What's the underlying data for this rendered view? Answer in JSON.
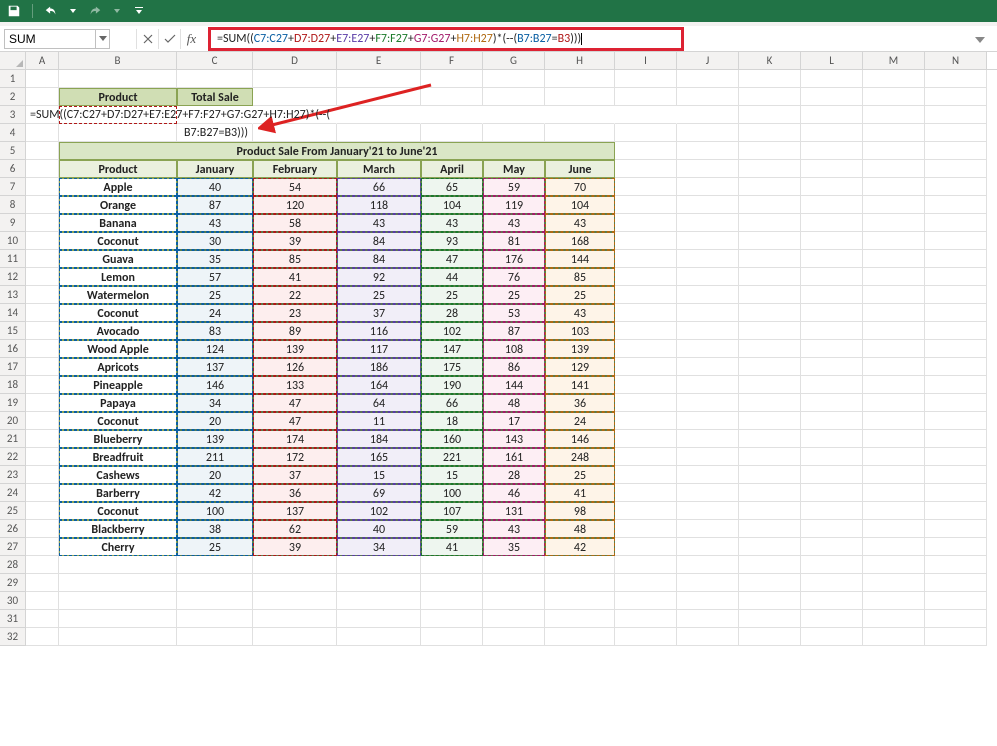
{
  "app": {
    "name_box": "SUM"
  },
  "formula_bar": {
    "prefix": "=SUM((",
    "r1": "C7:C27",
    "plus": "+",
    "r2": "D7:D27",
    "r3": "E7:E27",
    "r4": "F7:F27",
    "r5": "G7:G27",
    "r6": "H7:H27",
    "mid": ")*(--(",
    "r7": "B7:B27",
    "eq": "=",
    "r8": "B3",
    "suffix": ")))"
  },
  "cols": [
    "A",
    "B",
    "C",
    "D",
    "E",
    "F",
    "G",
    "H",
    "I",
    "J",
    "K",
    "L",
    "M",
    "N"
  ],
  "small_table": {
    "h1": "Product",
    "h2": "Total Sale",
    "r3a": "=SUM((C7:C27+D7:D27+E7:E27+F7:F27+G7:G27+H7:H27)*(--(",
    "r4a": "B7:B27=B3)))"
  },
  "main_table": {
    "title": "Product Sale From January'21 to June'21",
    "headers": [
      "Product",
      "January",
      "February",
      "March",
      "April",
      "May",
      "June"
    ],
    "rows": [
      [
        "Apple",
        "40",
        "54",
        "66",
        "65",
        "59",
        "70"
      ],
      [
        "Orange",
        "87",
        "120",
        "118",
        "104",
        "119",
        "104"
      ],
      [
        "Banana",
        "43",
        "58",
        "43",
        "43",
        "43",
        "43"
      ],
      [
        "Coconut",
        "30",
        "39",
        "84",
        "93",
        "81",
        "168"
      ],
      [
        "Guava",
        "35",
        "85",
        "84",
        "47",
        "176",
        "144"
      ],
      [
        "Lemon",
        "57",
        "41",
        "92",
        "44",
        "76",
        "85"
      ],
      [
        "Watermelon",
        "25",
        "22",
        "25",
        "25",
        "25",
        "25"
      ],
      [
        "Coconut",
        "24",
        "23",
        "37",
        "28",
        "53",
        "43"
      ],
      [
        "Avocado",
        "83",
        "89",
        "116",
        "102",
        "87",
        "103"
      ],
      [
        "Wood Apple",
        "124",
        "139",
        "117",
        "147",
        "108",
        "139"
      ],
      [
        "Apricots",
        "137",
        "126",
        "186",
        "175",
        "86",
        "129"
      ],
      [
        "Pineapple",
        "146",
        "133",
        "164",
        "190",
        "144",
        "141"
      ],
      [
        "Papaya",
        "34",
        "47",
        "64",
        "66",
        "48",
        "36"
      ],
      [
        "Coconut",
        "20",
        "47",
        "11",
        "18",
        "17",
        "24"
      ],
      [
        "Blueberry",
        "139",
        "174",
        "184",
        "160",
        "143",
        "146"
      ],
      [
        "Breadfruit",
        "211",
        "172",
        "165",
        "221",
        "161",
        "248"
      ],
      [
        "Cashews",
        "20",
        "37",
        "15",
        "15",
        "28",
        "25"
      ],
      [
        "Barberry",
        "42",
        "36",
        "69",
        "100",
        "46",
        "41"
      ],
      [
        "Coconut",
        "100",
        "137",
        "102",
        "107",
        "131",
        "98"
      ],
      [
        "Blackberry",
        "38",
        "62",
        "40",
        "59",
        "43",
        "48"
      ],
      [
        "Cherry",
        "25",
        "39",
        "34",
        "41",
        "35",
        "42"
      ]
    ]
  }
}
